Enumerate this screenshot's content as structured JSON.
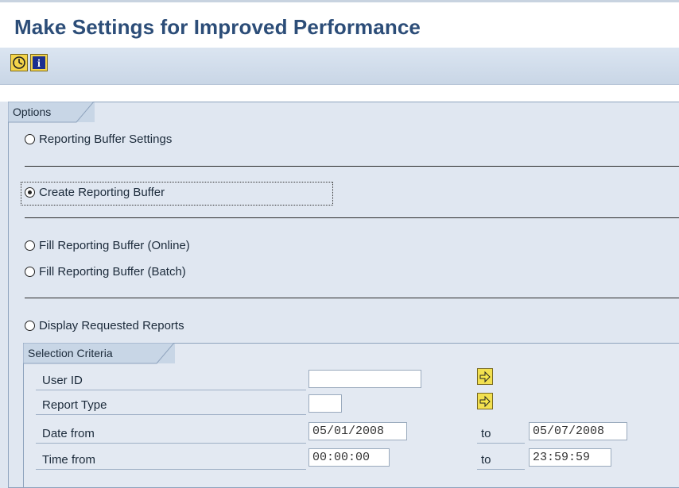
{
  "window": {
    "title": "Make Settings for Improved Performance"
  },
  "toolbar": {
    "execute_icon": "execute-icon",
    "info_icon": "info-icon"
  },
  "options": {
    "group_title": "Options",
    "items": [
      {
        "label": "Reporting Buffer Settings",
        "selected": false
      },
      {
        "label": "Create Reporting Buffer",
        "selected": true
      },
      {
        "label": "Fill Reporting Buffer (Online)",
        "selected": false
      },
      {
        "label": "Fill Reporting Buffer (Batch)",
        "selected": false
      },
      {
        "label": "Display Requested Reports",
        "selected": false
      }
    ]
  },
  "selection": {
    "group_title": "Selection Criteria",
    "user_id": {
      "label": "User ID",
      "value": ""
    },
    "report_type": {
      "label": "Report Type",
      "value": ""
    },
    "date": {
      "label": "Date from",
      "from": "05/01/2008",
      "to_label": "to",
      "to": "05/07/2008"
    },
    "time": {
      "label": "Time from",
      "from": "00:00:00",
      "to_label": "to",
      "to": "23:59:59"
    }
  },
  "colors": {
    "title": "#2c4d78",
    "background": "#dfe6f0",
    "accent_button": "#f2e050"
  }
}
